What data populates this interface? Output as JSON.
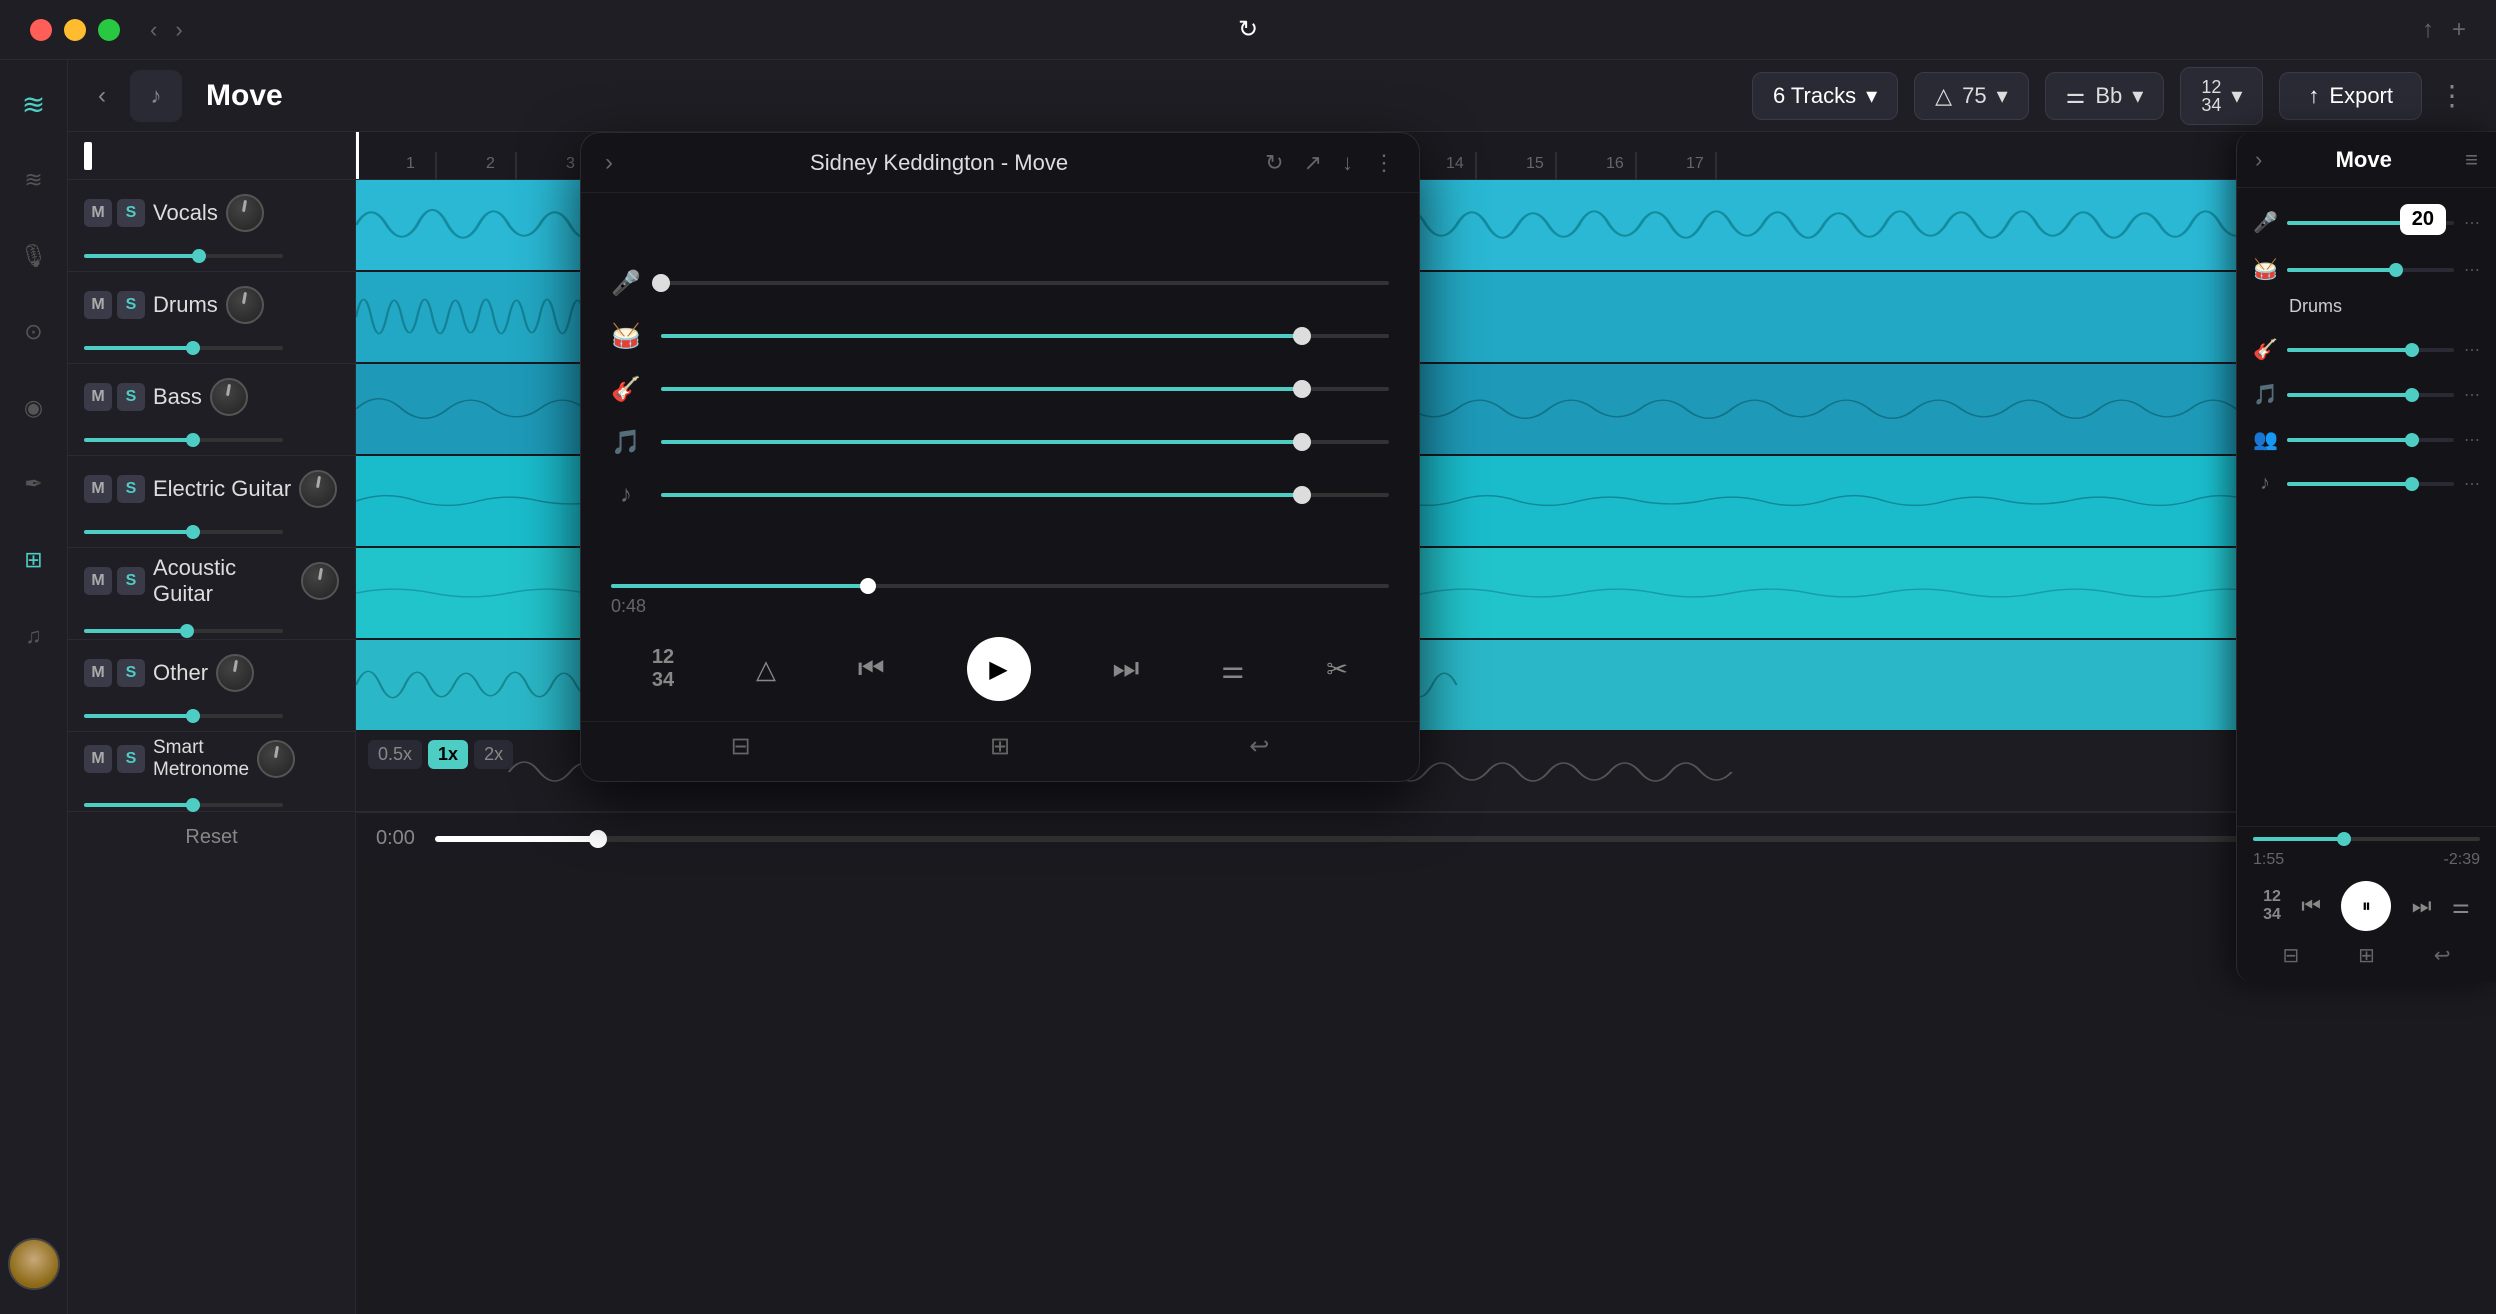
{
  "titlebar": {
    "nav_back": "‹",
    "nav_forward": "›",
    "reload_icon": "↻",
    "upload_icon": "↑",
    "add_icon": "+"
  },
  "sidebar": {
    "logo": "≋",
    "icons": [
      {
        "name": "layers-icon",
        "symbol": "⊞",
        "active": false
      },
      {
        "name": "mic-icon",
        "symbol": "🎙",
        "active": false
      },
      {
        "name": "save-icon",
        "symbol": "⊡",
        "active": false
      },
      {
        "name": "ear-icon",
        "symbol": "◎",
        "active": false
      },
      {
        "name": "brush-icon",
        "symbol": "✏",
        "active": false
      },
      {
        "name": "grid-icon",
        "symbol": "⊞",
        "active": true
      },
      {
        "name": "notes-icon",
        "symbol": "♪",
        "active": false
      }
    ]
  },
  "header": {
    "back_label": "‹",
    "song_icon": "♪",
    "song_title": "Move",
    "tracks_label": "6 Tracks",
    "tracks_dropdown": "▾",
    "tempo_icon": "△",
    "tempo_value": "75",
    "tempo_dropdown": "▾",
    "key_icon": "≡",
    "key_value": "Bb",
    "key_dropdown": "▾",
    "time_sig": "12/34",
    "time_dropdown": "▾",
    "export_icon": "↑",
    "export_label": "Export",
    "more_icon": "⋮"
  },
  "tracks": [
    {
      "id": "vocals",
      "name": "Vocals",
      "m": "M",
      "s": "S",
      "volume_pct": 58,
      "color": "#4ecdc4",
      "waveform_color": "#5ad4e0",
      "bg_color": "#2ab8d4"
    },
    {
      "id": "drums",
      "name": "Drums",
      "m": "M",
      "s": "S",
      "volume_pct": 55,
      "color": "#4ecdc4",
      "waveform_color": "#4ecdc4",
      "bg_color": "#22a8c4"
    },
    {
      "id": "bass",
      "name": "Bass",
      "m": "M",
      "s": "S",
      "volume_pct": 55,
      "color": "#4ecdc4",
      "waveform_color": "#4ecdc4",
      "bg_color": "#1e9ab8"
    },
    {
      "id": "electric-guitar",
      "name": "Electric Guitar",
      "m": "M",
      "s": "S",
      "volume_pct": 55,
      "color": "#4ecdc4",
      "waveform_color": "#4ecdc4",
      "bg_color": "#1abccc"
    },
    {
      "id": "acoustic-guitar",
      "name": "Acoustic Guitar",
      "m": "M",
      "s": "S",
      "volume_pct": 52,
      "color": "#4ecdc4",
      "waveform_color": "#4ecdc4",
      "bg_color": "#22c4cc"
    },
    {
      "id": "other",
      "name": "Other",
      "m": "M",
      "s": "S",
      "volume_pct": 55,
      "color": "#4ecdc4",
      "waveform_color": "#4ecdc4",
      "bg_color": "#2ab8c8"
    },
    {
      "id": "metronome",
      "name": "Smart Metronome",
      "m": "M",
      "s": "S",
      "volume_pct": 55,
      "color": "#4ecdc4",
      "waveform_color": "#888",
      "bg_color": "#222"
    }
  ],
  "speed_buttons": [
    "0.5x",
    "1x",
    "2x"
  ],
  "active_speed": "1x",
  "bottom_time": "0:00",
  "reset_label": "Reset",
  "modal": {
    "title": "Sidney Keddington - Move",
    "progress_time": "0:48",
    "total_time": "",
    "time_start": "1:55",
    "time_end": "-2:39",
    "chevron_icon": "›",
    "refresh_icon": "↻",
    "share_icon": "↗",
    "download_icon": "↓",
    "more_icon": "⋮",
    "sliders": [
      {
        "icon": "🎤",
        "pct": 0,
        "icon_name": "mic-stem"
      },
      {
        "icon": "🥁",
        "pct": 88,
        "icon_name": "drums-stem"
      },
      {
        "icon": "🎸",
        "pct": 88,
        "icon_name": "guitar-stem"
      },
      {
        "icon": "🎵",
        "pct": 88,
        "icon_name": "other-stem"
      },
      {
        "icon": "♪",
        "pct": 88,
        "icon_name": "music-stem"
      }
    ],
    "controls": {
      "time_sig_icon": "12/34",
      "metronome_icon": "△",
      "rewind_icon": "⏮",
      "play_icon": "▶",
      "forward_icon": "⏭",
      "eq_icon": "≡",
      "scissors_icon": "✂"
    },
    "bottom_icons": [
      {
        "icon": "⊟",
        "name": "subtitles-icon"
      },
      {
        "icon": "⊞",
        "name": "grid-icon"
      },
      {
        "icon": "↩",
        "name": "return-icon"
      }
    ]
  },
  "right_panel": {
    "title": "Move",
    "menu_icon": "≡",
    "chevron_icon": "›",
    "stems": [
      {
        "icon": "🎤",
        "pct": 75,
        "name": "vocals-rp",
        "label": "",
        "tooltip": "20"
      },
      {
        "icon": "🥁",
        "pct": 65,
        "name": "drums-rp",
        "label": "Drums",
        "tooltip": null
      },
      {
        "icon": "🎸",
        "pct": 75,
        "name": "guitar-rp",
        "label": "",
        "tooltip": null
      },
      {
        "icon": "🎵",
        "pct": 75,
        "name": "other-rp",
        "label": "",
        "tooltip": null
      },
      {
        "icon": "👥",
        "pct": 75,
        "name": "crowd-rp",
        "label": "",
        "tooltip": null
      },
      {
        "icon": "♪",
        "pct": 75,
        "name": "music-rp",
        "label": "",
        "tooltip": null
      }
    ],
    "time_start": "1:55",
    "time_end": "-2:39",
    "controls": {
      "speed_icon": "🎵",
      "rewind_icon": "⏮",
      "pause_icon": "⏸",
      "forward_icon": "⏭",
      "eq_icon": "≡"
    },
    "bottom_icons": [
      {
        "icon": "⊟",
        "name": "sub-icon"
      },
      {
        "icon": "⊞",
        "name": "grid-icon"
      },
      {
        "icon": "↩",
        "name": "return-icon"
      }
    ]
  }
}
